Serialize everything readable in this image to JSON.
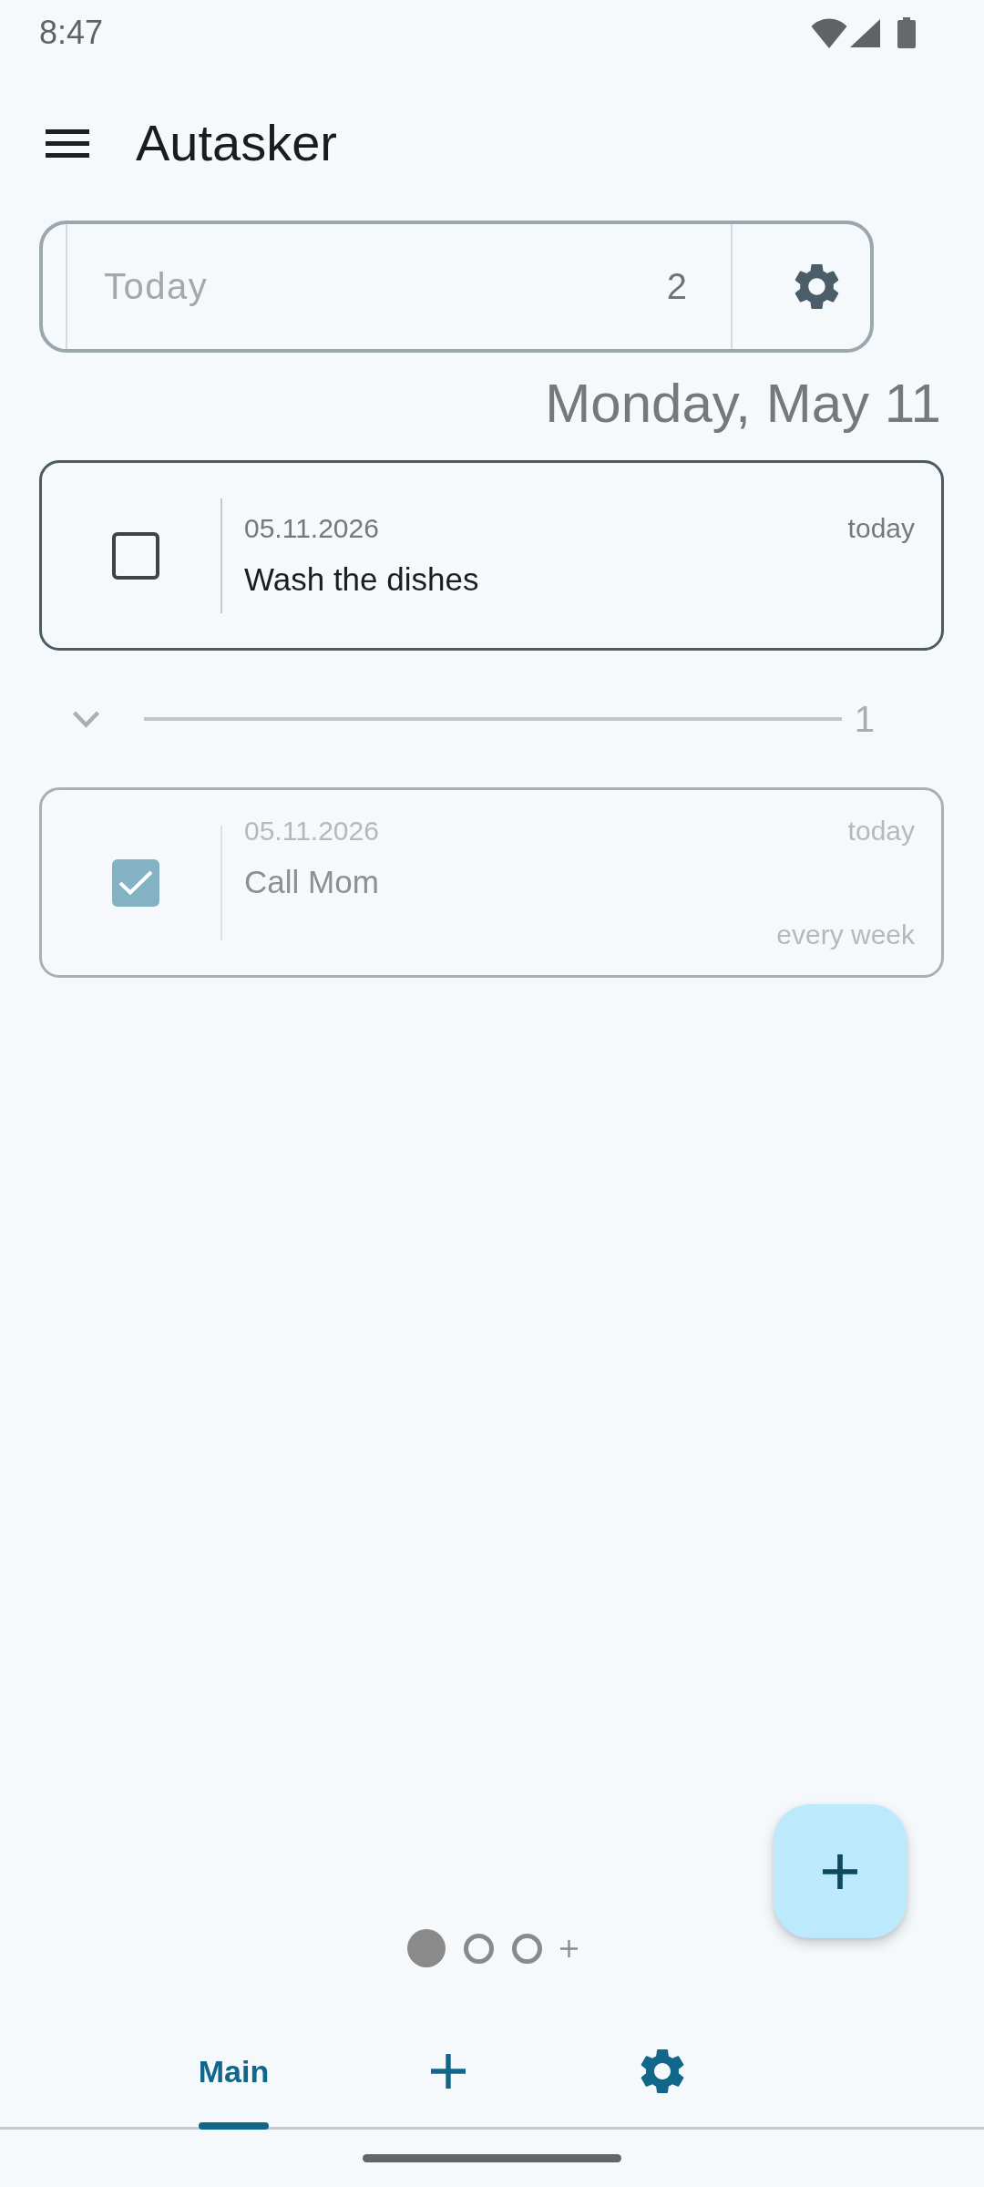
{
  "status_bar": {
    "time": "8:47"
  },
  "app_bar": {
    "title": "Autasker"
  },
  "list_filter": {
    "value": "Today",
    "count": "2"
  },
  "date_heading": "Monday, May 11",
  "tasks": [
    {
      "date": "05.11.2026",
      "due": "today",
      "title": "Wash the dishes",
      "checked": false
    }
  ],
  "completed_section": {
    "expanded": true,
    "count": "1",
    "tasks": [
      {
        "date": "05.11.2026",
        "due": "today",
        "title": "Call Mom",
        "repeat": "every week",
        "checked": true
      }
    ]
  },
  "pages": [
    {
      "selected": true
    },
    {
      "selected": false
    },
    {
      "selected": false
    }
  ],
  "tabs": [
    {
      "kind": "label",
      "label": "Main",
      "selected": true
    },
    {
      "kind": "add",
      "selected": false
    },
    {
      "kind": "settings",
      "selected": false
    }
  ]
}
